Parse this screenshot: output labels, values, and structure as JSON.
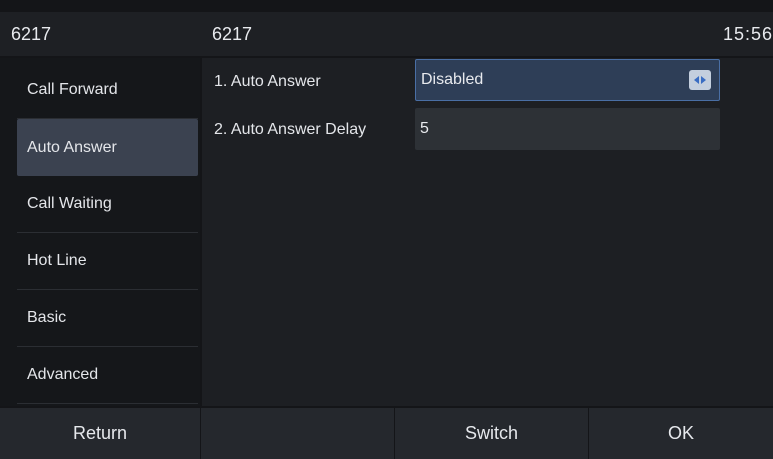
{
  "statusbar": {
    "account": "6217",
    "title": "6217",
    "time": "15:56"
  },
  "sidebar": {
    "items": [
      {
        "label": "Call Forward",
        "active": false
      },
      {
        "label": "Auto Answer",
        "active": true
      },
      {
        "label": "Call Waiting",
        "active": false
      },
      {
        "label": "Hot Line",
        "active": false
      },
      {
        "label": "Basic",
        "active": false
      },
      {
        "label": "Advanced",
        "active": false
      }
    ]
  },
  "settings": {
    "rows": [
      {
        "label": "1. Auto Answer",
        "value": "Disabled",
        "control": "switch-selector"
      },
      {
        "label": "2. Auto Answer Delay",
        "value": "5",
        "control": "text-input"
      }
    ]
  },
  "softkeys": [
    "Return",
    "",
    "Switch",
    "OK"
  ],
  "colors": {
    "background": "#141518",
    "active_item": "#3b4250",
    "focused_field": "#2e3e57",
    "field": "#2d3136",
    "softkey": "#25282d"
  }
}
